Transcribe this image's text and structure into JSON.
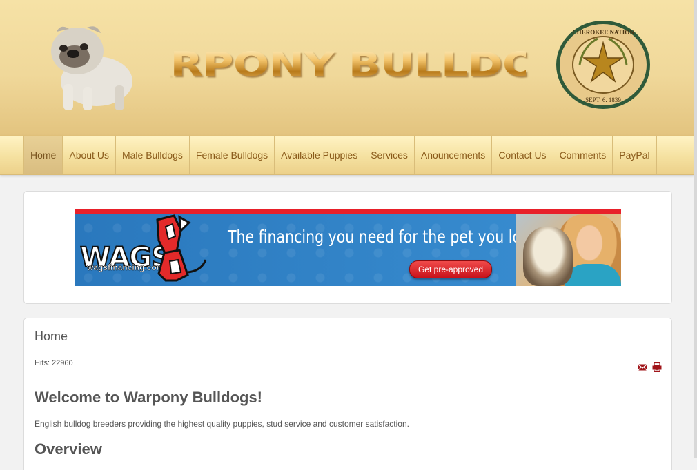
{
  "header": {
    "logo_text": "WARPONY BULLDOGS",
    "seal_text_top": "SEAL OF THE CHEROKEE NATION",
    "seal_text_bottom": "SEPT. 6. 1839"
  },
  "nav": {
    "items": [
      {
        "label": "Home",
        "active": true
      },
      {
        "label": "About Us"
      },
      {
        "label": "Male Bulldogs"
      },
      {
        "label": "Female Bulldogs"
      },
      {
        "label": "Available Puppies"
      },
      {
        "label": "Services"
      },
      {
        "label": "Anouncements"
      },
      {
        "label": "Contact Us"
      },
      {
        "label": "Comments"
      },
      {
        "label": "PayPal"
      }
    ]
  },
  "banner": {
    "brand": "WAGS",
    "url": "wagsfinancing.com",
    "tagline": "The financing you need for the pet you love.",
    "cta": "Get pre-approved"
  },
  "article": {
    "page_title": "Home",
    "hits": "Hits: 22960",
    "heading": "Welcome to Warpony Bulldogs!",
    "intro": "English bulldog breeders providing the highest quality puppies, stud service and customer satisfaction.",
    "overview_heading": "Overview"
  },
  "icons": {
    "email": "envelope-icon",
    "print": "printer-icon"
  },
  "colors": {
    "header_gold": "#f0d89a",
    "nav_text": "#8a5a1a",
    "banner_blue": "#2b7fc4",
    "banner_red": "#e8202a",
    "icon_red": "#a0151a"
  }
}
